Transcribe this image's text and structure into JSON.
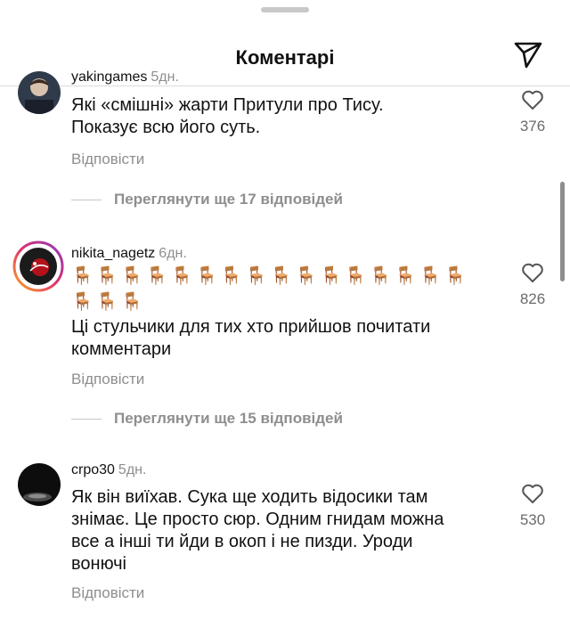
{
  "header": {
    "title": "Коментарі"
  },
  "comments": [
    {
      "username": "yakingames",
      "time": "5дн.",
      "text": "Які «смішні» жарти Притули про Тису.\nПоказує всю його суть.",
      "likes": "376",
      "reply_label": "Відповісти",
      "view_replies": "Переглянути ще 17 відповідей"
    },
    {
      "username": "nikita_nagetz",
      "time": "6дн.",
      "emoji": "🪑🪑🪑🪑🪑🪑🪑🪑🪑🪑🪑🪑🪑🪑🪑🪑🪑🪑🪑",
      "text": "Ці стульчики для тих хто прийшов почитати\nкомментари",
      "likes": "826",
      "reply_label": "Відповісти",
      "view_replies": "Переглянути ще 15 відповідей"
    },
    {
      "username": "crpo30",
      "time": "5дн.",
      "text": "Як він виїхав. Сука ще ходить відосики там\nзнімає. Це просто сюр. Одним гнидам можна\nвсе а інші ти йди в окоп і не пизди. Уроди\nвонючі",
      "likes": "530",
      "reply_label": "Відповісти"
    }
  ],
  "colors": {
    "text": "#111111",
    "muted": "#8e8e8e",
    "accent_ring": "#e1306c"
  },
  "icons": {
    "share": "paper-plane-icon",
    "like": "heart-outline-icon"
  }
}
